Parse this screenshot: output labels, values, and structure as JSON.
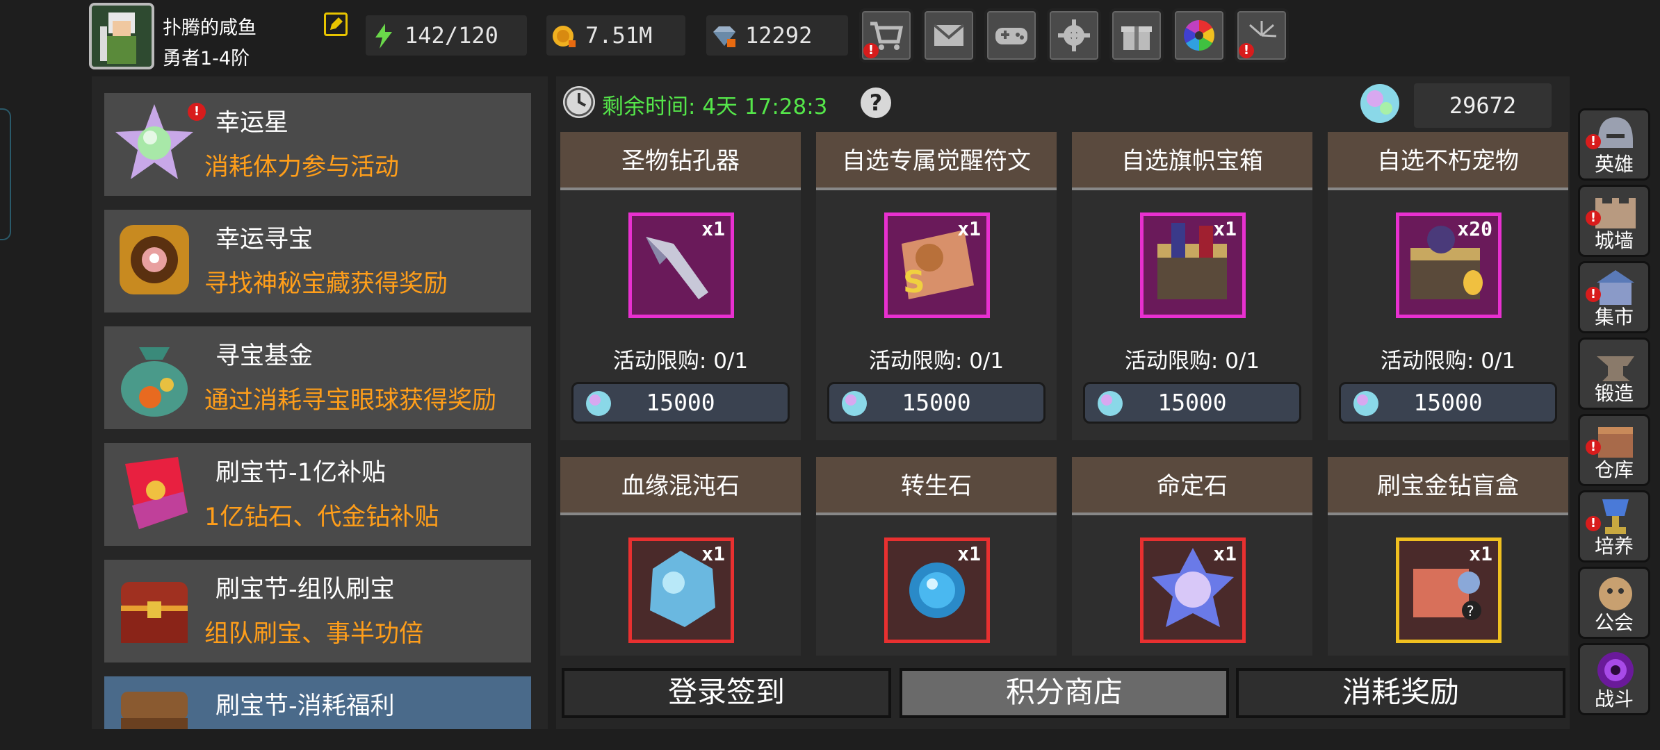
{
  "player": {
    "name": "扑腾的咸鱼",
    "rank": "勇者1-4阶"
  },
  "resources": [
    {
      "icon": "lightning-icon",
      "value": "142/120"
    },
    {
      "icon": "gold-coin-icon",
      "value": "7.51M"
    },
    {
      "icon": "diamond-icon",
      "value": "12292"
    }
  ],
  "top_icons": [
    {
      "name": "shop-cart-icon",
      "alert": true
    },
    {
      "name": "mail-icon",
      "alert": false
    },
    {
      "name": "gamepad-icon",
      "alert": false
    },
    {
      "name": "settings-gear-icon",
      "alert": false
    },
    {
      "name": "gift-icon",
      "alert": false
    },
    {
      "name": "color-wheel-icon",
      "alert": false
    },
    {
      "name": "fireworks-icon",
      "alert": true
    }
  ],
  "events": [
    {
      "title": "幸运星",
      "desc": "消耗体力参与活动",
      "alert": true
    },
    {
      "title": "幸运寻宝",
      "desc": "寻找神秘宝藏获得奖励",
      "alert": false
    },
    {
      "title": "寻宝基金",
      "desc": "通过消耗寻宝眼球获得奖励",
      "alert": false
    },
    {
      "title": "刷宝节-1亿补贴",
      "desc": "1亿钻石、代金钻补贴",
      "alert": false
    },
    {
      "title": "刷宝节-组队刷宝",
      "desc": "组队刷宝、事半功倍",
      "alert": false
    },
    {
      "title": "刷宝节-消耗福利",
      "desc": "",
      "alert": false
    }
  ],
  "timer": {
    "label": "剩余时间: 4天 17:28:3",
    "help": "?"
  },
  "points": {
    "value": "29672"
  },
  "shop_items": [
    {
      "name": "圣物钻孔器",
      "qty": "x1",
      "limit": "活动限购:  0/1",
      "price": "15000",
      "frame": "purple"
    },
    {
      "name": "自选专属觉醒符文",
      "qty": "x1",
      "limit": "活动限购:  0/1",
      "price": "15000",
      "frame": "purple"
    },
    {
      "name": "自选旗帜宝箱",
      "qty": "x1",
      "limit": "活动限购:  0/1",
      "price": "15000",
      "frame": "purple"
    },
    {
      "name": "自选不朽宠物",
      "qty": "x20",
      "limit": "活动限购:  0/1",
      "price": "15000",
      "frame": "purple"
    },
    {
      "name": "血缘混沌石",
      "qty": "x1",
      "frame": "red"
    },
    {
      "name": "转生石",
      "qty": "x1",
      "frame": "red"
    },
    {
      "name": "命定石",
      "qty": "x1",
      "frame": "red"
    },
    {
      "name": "刷宝金钻盲盒",
      "qty": "x1",
      "frame": "gold"
    }
  ],
  "tabs": [
    {
      "label": "登录签到",
      "active": false
    },
    {
      "label": "积分商店",
      "active": true
    },
    {
      "label": "消耗奖励",
      "active": false
    }
  ],
  "right_nav": [
    {
      "label": "英雄",
      "icon": "hero-helmet-icon",
      "alert": true
    },
    {
      "label": "城墙",
      "icon": "city-wall-icon",
      "alert": true
    },
    {
      "label": "集市",
      "icon": "market-icon",
      "alert": true
    },
    {
      "label": "锻造",
      "icon": "anvil-icon",
      "alert": false
    },
    {
      "label": "仓库",
      "icon": "warehouse-icon",
      "alert": true
    },
    {
      "label": "培养",
      "icon": "trophy-cup-icon",
      "alert": true
    },
    {
      "label": "公会",
      "icon": "guild-icon",
      "alert": false
    },
    {
      "label": "战斗",
      "icon": "battle-portal-icon",
      "alert": false
    }
  ],
  "colors": {
    "accent_orange": "#ff9e1a",
    "timer_green": "#55e64a",
    "alert_red": "#d81c1c"
  }
}
